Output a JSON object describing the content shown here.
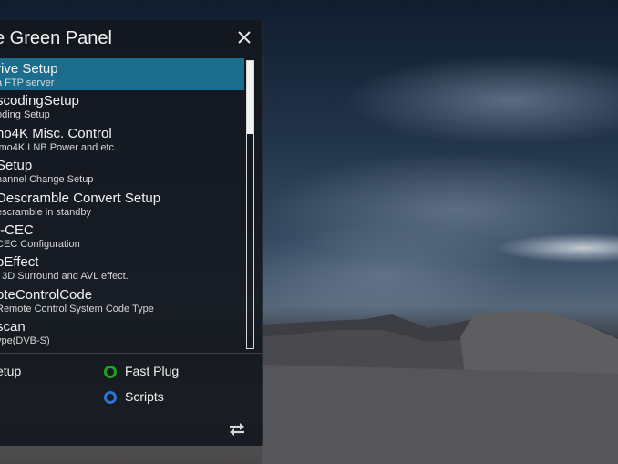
{
  "panel": {
    "title": "e Green Panel"
  },
  "list": {
    "items": [
      {
        "title": "rive Setup",
        "sub": "a FTP server",
        "selected": true
      },
      {
        "title": "scodingSetup",
        "sub": "oding Setup"
      },
      {
        "title": "no4K Misc. Control",
        "sub": "imo4K LNB Power and etc.."
      },
      {
        "title": "Setup",
        "sub": "hannel Change Setup"
      },
      {
        "title": "Descramble Convert Setup",
        "sub": "escramble in standby"
      },
      {
        "title": "I-CEC",
        "sub": "CEC Configuration"
      },
      {
        "title": "oEffect",
        "sub": "t 3D Surround and AVL effect."
      },
      {
        "title": "oteControlCode",
        "sub": "Remote Control System Code Type"
      },
      {
        "title": "scan",
        "sub": "ype(DVB-S)"
      }
    ]
  },
  "buttons": {
    "setup_label": "etup",
    "fast_plug_label": "Fast Plug",
    "scripts_label": "Scripts"
  },
  "icons": {
    "close": "close-icon",
    "switch": "switch-arrows-icon",
    "green_button": "green-circle-icon",
    "blue_button": "blue-circle-icon"
  },
  "colors": {
    "selection": "#1c6d8d",
    "green": "#1fa21f",
    "blue": "#2a74d6"
  }
}
